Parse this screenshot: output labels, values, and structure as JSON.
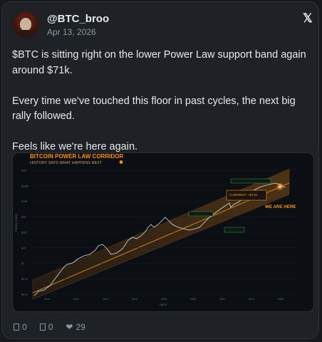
{
  "tweet": {
    "user_name": "@BTC_broo",
    "date": "Apr 13, 2026",
    "text": "$BTC is sitting right on the lower Power Law support band again around $71k.\n\nEvery time we've touched this floor in past cycles, the next big rally followed.\n\nFeels like we're here again.",
    "x_glyph": "𝕏"
  },
  "chart": {
    "title": "BITCOIN POWER LAW CORRIDOR",
    "subtitle": "HISTORY SAYS WHAT HAPPENS NEXT",
    "current_label": "CURRENT: ~$71K",
    "we_are_here": "WE ARE HERE",
    "y_axis_label": "PRICE (USD)",
    "x_axis_label": "DATE",
    "y_ticks": [
      "$1M",
      "$100K",
      "$10K",
      "$1K",
      "$100",
      "$10",
      "$1",
      "$0.10",
      "$0.01"
    ],
    "x_ticks": [
      "2010",
      "2012",
      "2014",
      "2016",
      "2018",
      "2020",
      "2022",
      "2024",
      "2026"
    ],
    "colors": {
      "accent": "#f7931a",
      "green": "#3fb950",
      "price_line": "#d9dde3"
    }
  },
  "stats": {
    "replies": "0",
    "reposts": "0",
    "likes": "29"
  },
  "icons": {
    "reply": "comment-icon",
    "repost": "repost-icon",
    "like": "heart-icon"
  }
}
